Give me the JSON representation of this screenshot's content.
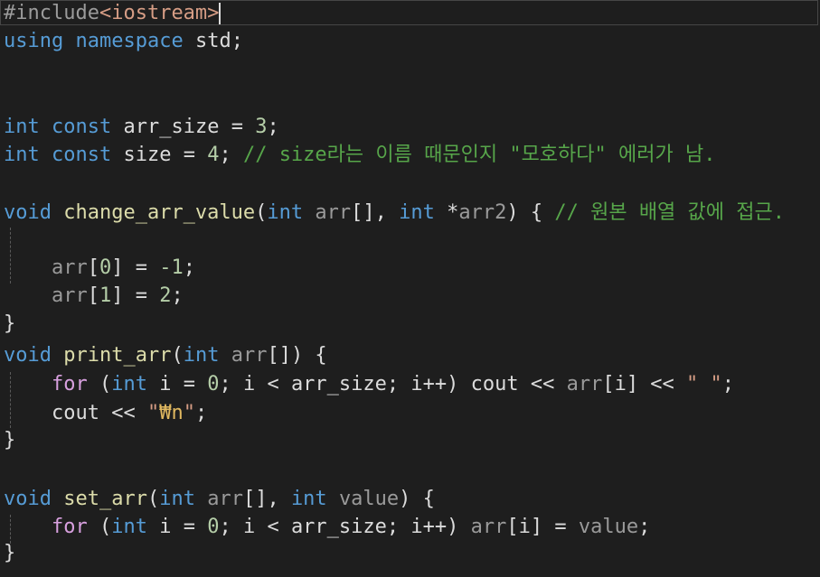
{
  "editor": {
    "lines": {
      "l1": {
        "a": "#include",
        "b": "<iostream>"
      },
      "l2": {
        "a": "using",
        "b": "namespace",
        "c": "std;"
      },
      "l5": {
        "a": "int",
        "b": "const",
        "c": "arr_size = ",
        "d": "3",
        "e": ";"
      },
      "l6": {
        "a": "int",
        "b": "const",
        "c": "size = ",
        "d": "4",
        "e": ";",
        "f": "// size라는 이름 때문인지 \"모호하다\" 에러가 남."
      },
      "l8": {
        "a": "void",
        "b": "change_arr_value",
        "c": "(",
        "d": "int",
        "e": "arr",
        "f": "[], ",
        "g": "int",
        "h": "*",
        "i": "arr2",
        "j": ") { ",
        "k": "// 원본 배열 값에 접근."
      },
      "l9": {
        "a": "arr",
        "b": "[",
        "c": "0",
        "d": "] = ",
        "e": "-1",
        "f": ";"
      },
      "l10": {
        "a": "arr",
        "b": "[",
        "c": "1",
        "d": "] = ",
        "e": "2",
        "f": ";"
      },
      "l11": {
        "a": "}"
      },
      "l13": {
        "a": "void",
        "b": "print_arr",
        "c": "(",
        "d": "int",
        "e": "arr",
        "f": "[]) {"
      },
      "l14": {
        "a": "for",
        "b": " (",
        "c": "int",
        "d": " i = ",
        "e": "0",
        "f": "; i < arr_size; i++) cout << ",
        "g": "arr",
        "h": "[i] << ",
        "i": "\" \"",
        "j": ";"
      },
      "l15": {
        "a": "cout << ",
        "b": "\"",
        "c": "₩n",
        "d": "\"",
        "e": ";"
      },
      "l16": {
        "a": "}"
      },
      "l18": {
        "a": "void",
        "b": "set_arr",
        "c": "(",
        "d": "int",
        "e": "arr",
        "f": "[], ",
        "g": "int",
        "h": "value",
        "i": ") {"
      },
      "l19": {
        "a": "for",
        "b": " (",
        "c": "int",
        "d": " i = ",
        "e": "0",
        "f": "; i < arr_size; i++) ",
        "g": "arr",
        "h": "[i] = ",
        "i": "value",
        "j": ";"
      },
      "l20": {
        "a": "}"
      }
    }
  }
}
